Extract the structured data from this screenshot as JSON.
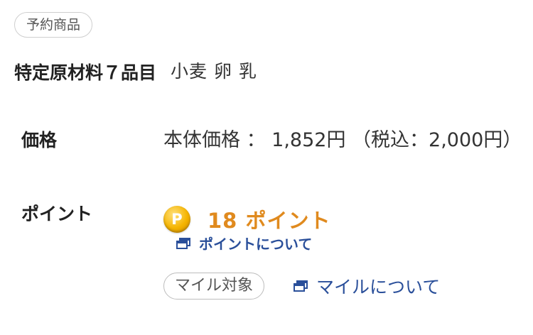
{
  "reservation_badge": "予約商品",
  "allergens": {
    "label": "特定原材料７品目",
    "value": "小麦 卵 乳"
  },
  "price": {
    "label": "価格",
    "value": "本体価格 ： 1,852円 （税込：2,000円）"
  },
  "points": {
    "label": "ポイント",
    "coin_letter": "P",
    "amount": "18 ポイント",
    "about_link": "ポイントについて"
  },
  "miles": {
    "badge": "マイル対象",
    "about_link": "マイルについて"
  },
  "colors": {
    "points_accent": "#e08a1e",
    "link": "#2a4f9a",
    "coin": "#f5b400"
  },
  "icons": {
    "coin": "point-coin-icon",
    "external_window": "new-window-icon"
  }
}
